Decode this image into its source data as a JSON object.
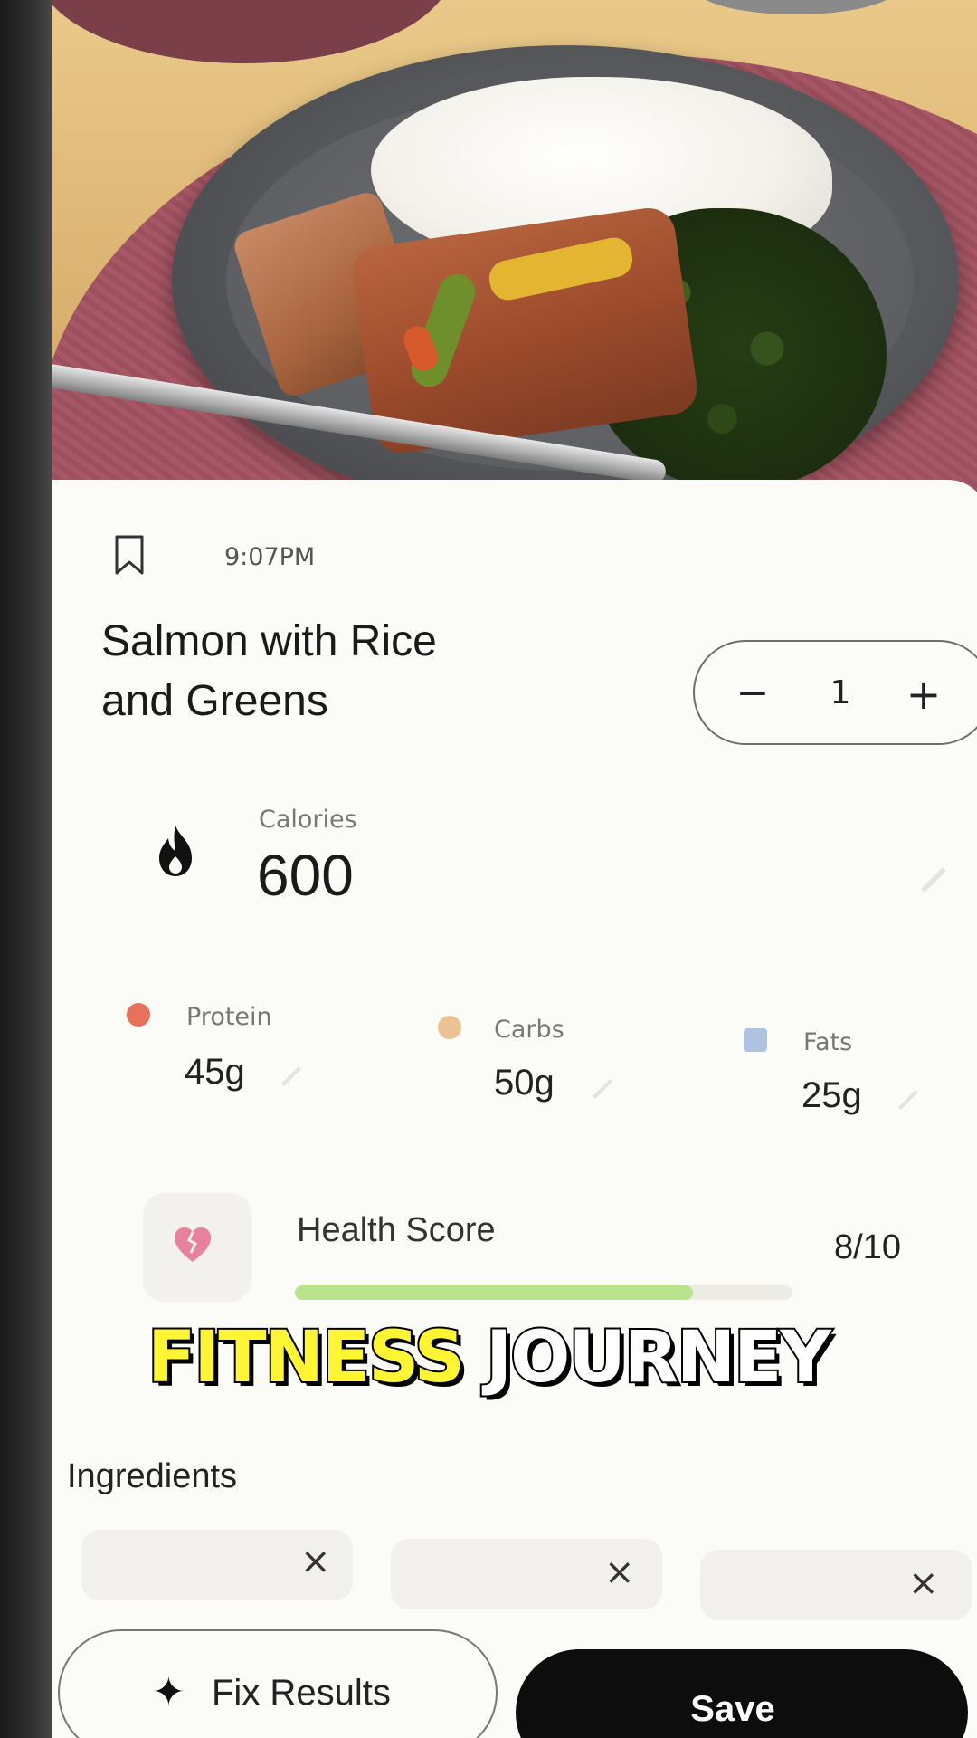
{
  "meal": {
    "time": "9:07PM",
    "title_line1": "Salmon with Rice",
    "title_line2": "and Greens",
    "quantity": {
      "minus": "−",
      "count": "1",
      "plus": "+"
    }
  },
  "calories": {
    "label": "Calories",
    "value": "600"
  },
  "macros": [
    {
      "label": "Protein",
      "value": "45g",
      "color": "#e8715a"
    },
    {
      "label": "Carbs",
      "value": "50g",
      "color": "#e6a86a"
    },
    {
      "label": "Fats",
      "value": "25g",
      "color": "#7b9fd4"
    }
  ],
  "health": {
    "label": "Health Score",
    "score": "8/10",
    "fraction": 0.8,
    "bar_color": "#b9e38d",
    "heart_color": "#e8829a"
  },
  "caption": {
    "word1": "FITNESS",
    "word2": "JOURNEY"
  },
  "ingredients": {
    "label": "Ingredients",
    "remove_glyph": "×"
  },
  "actions": {
    "fix_icon": "✦",
    "fix_label": "Fix Results",
    "save_label": "Save"
  }
}
